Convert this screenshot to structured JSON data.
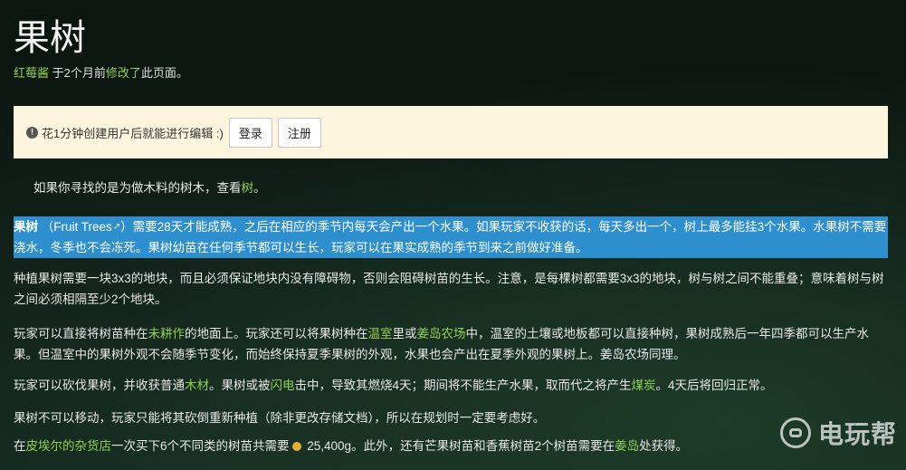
{
  "page": {
    "title": "果树",
    "meta": {
      "user": "红莓酱",
      "before": " 于2个月前",
      "action": "修改了",
      "after": "此页面。"
    }
  },
  "notice": {
    "text": "花1分钟创建用户后就能进行编辑 :)",
    "login_label": "登录",
    "register_label": "注册"
  },
  "body": {
    "p0": {
      "before": "如果你寻找的是为做木料的树木，查看",
      "link": "树",
      "after": "。"
    },
    "p1": {
      "bold": "果树",
      "paren_open": " （",
      "ext_link": "Fruit Trees",
      "rest": "）需要28天才能成熟，之后在相应的季节内每天会产出一个水果。如果玩家不收获的话，每天多出一个，树上最多能挂3个水果。水果树不需要浇水，冬季也不会冻死。果树幼苗在任何季节都可以生长，玩家可以在果实成熟的季节到来之前做好准备。"
    },
    "p2": "种植果树需要一块3x3的地块，而且必须保证地块内没有障碍物，否则会阻碍树苗的生长。注意，是每棵树都需要3x3的地块，树与树之间不能重叠；意味着树与树之间必须相隔至少2个地块。",
    "p3": {
      "t1": "玩家可以直接将树苗种在",
      "l1": "未耕作",
      "t2": "的地面上。玩家还可以将果树种在",
      "l2": "温室",
      "t3": "里或",
      "l3": "姜岛农场",
      "t4": "中，温室的土壤或地板都可以直接种树，果树成熟后一年四季都可以生产水果。但温室中的果树外观不会随季节变化，而始终保持夏季果树的外观，水果也会产出在夏季外观的果树上。姜岛农场同理。"
    },
    "p4": {
      "t1": "玩家可以砍伐果树，并收获普通",
      "l1": "木材",
      "t2": "。果树或被",
      "l2": "闪电",
      "t3": "击中，导致其燃烧4天；期间将不能生产水果，取而代之将产生",
      "l3": "煤炭",
      "t4": "。4天后将回归正常。"
    },
    "p5": "果树不可以移动，玩家只能将其砍倒重新种植（除非更改存储文档），所以在规划时一定要考虑好。",
    "p6": {
      "t1": "在",
      "l1": "皮埃尔的杂货店",
      "t2": "一次买下6个不同类的树苗共需要",
      "price": " 25,400g",
      "t3": "。此外，还有芒果树苗和香蕉树苗2个树苗需要在",
      "l2": "姜岛",
      "t4": "处获得。"
    }
  },
  "watermark": {
    "text": "电玩帮"
  },
  "colors": {
    "link": "#8fd14f",
    "highlight": "#2e8fce",
    "notice_bg": "#fdf5dd"
  }
}
